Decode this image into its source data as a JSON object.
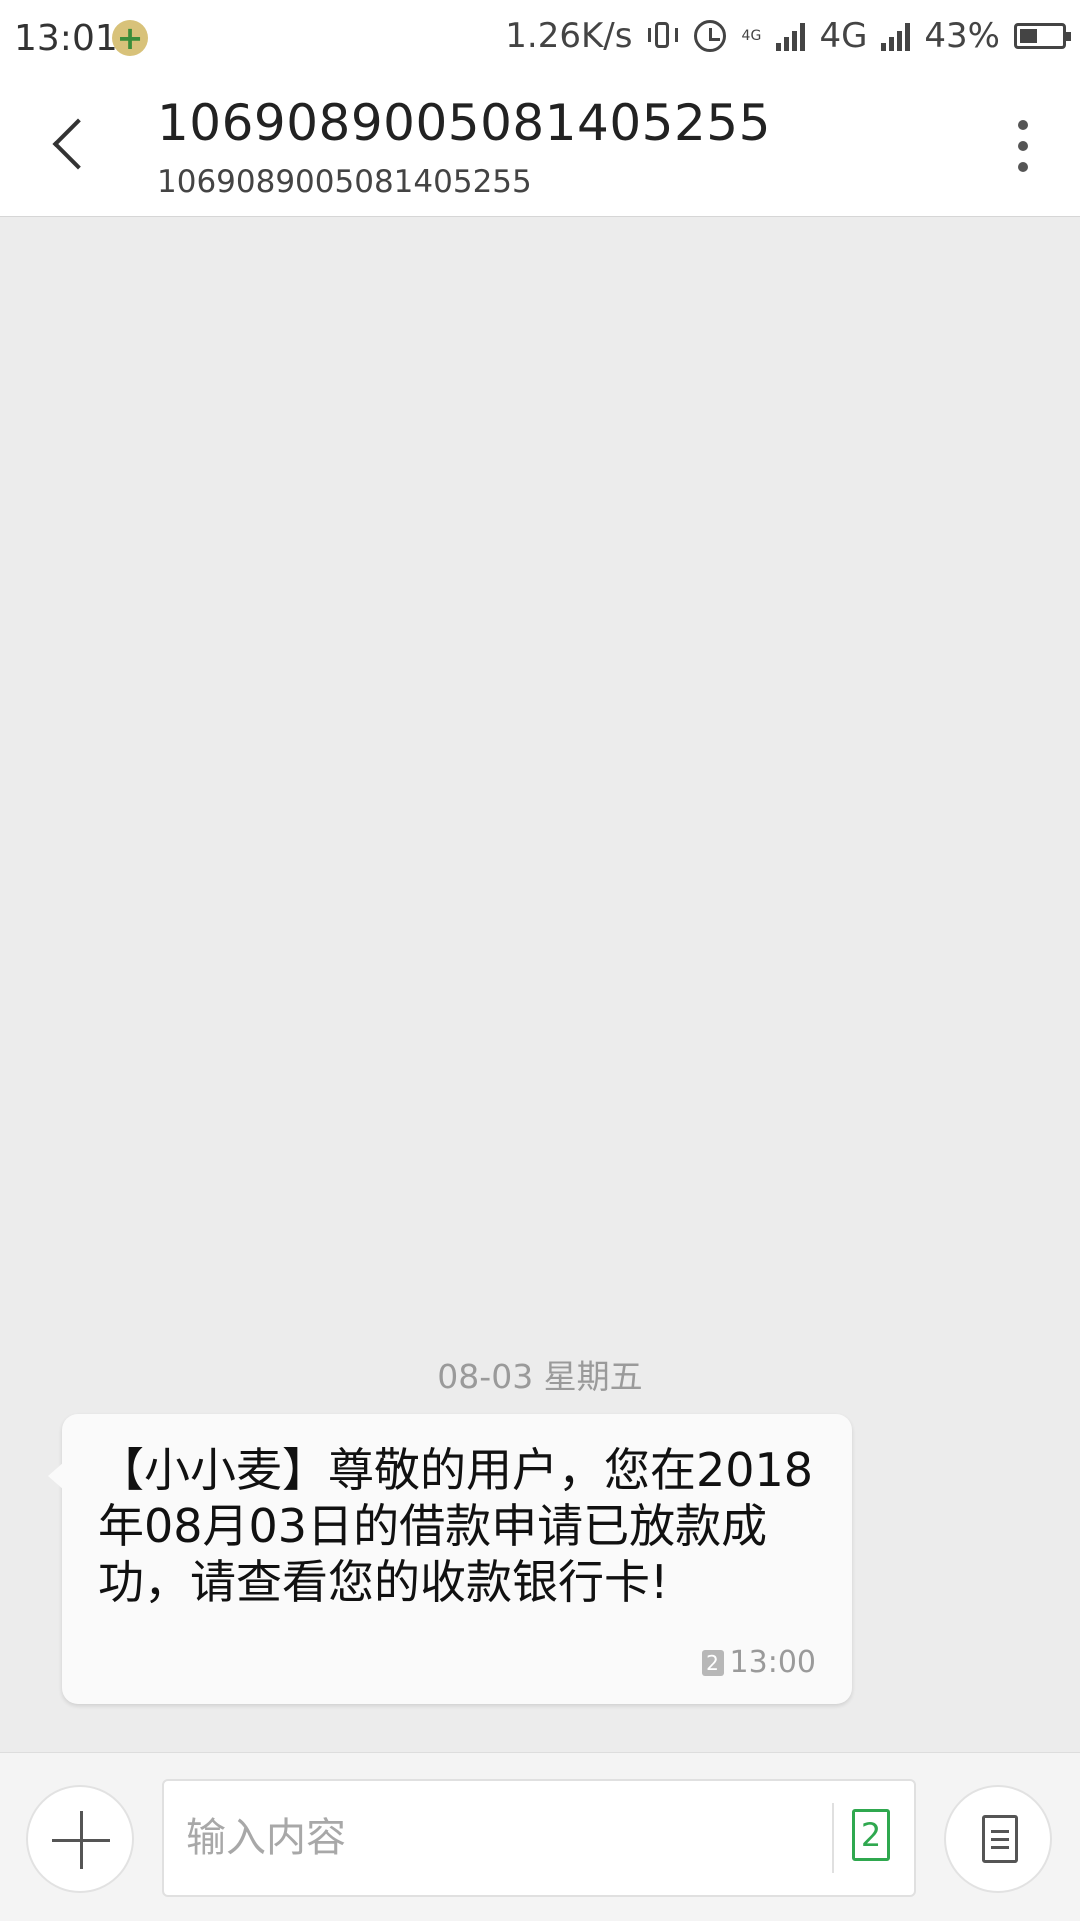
{
  "status_bar": {
    "time": "13:01",
    "net_speed": "1.26K/s",
    "network_type": "4G",
    "small_network_label": "4G",
    "battery_percent": "43%",
    "battery_level": 0.43
  },
  "header": {
    "title": "106908900508140​5255",
    "subtitle": "1069089005081405255"
  },
  "conversation": {
    "date_label": "08-03  星期五",
    "messages": [
      {
        "text": "【小小麦】尊敬的用户，您在2018年08月03日的借款申请已放款成功，请查看您的收款银行卡!",
        "sim": "2",
        "time": "13:00"
      }
    ]
  },
  "input_bar": {
    "placeholder": "输入内容",
    "sim_label": "2"
  }
}
